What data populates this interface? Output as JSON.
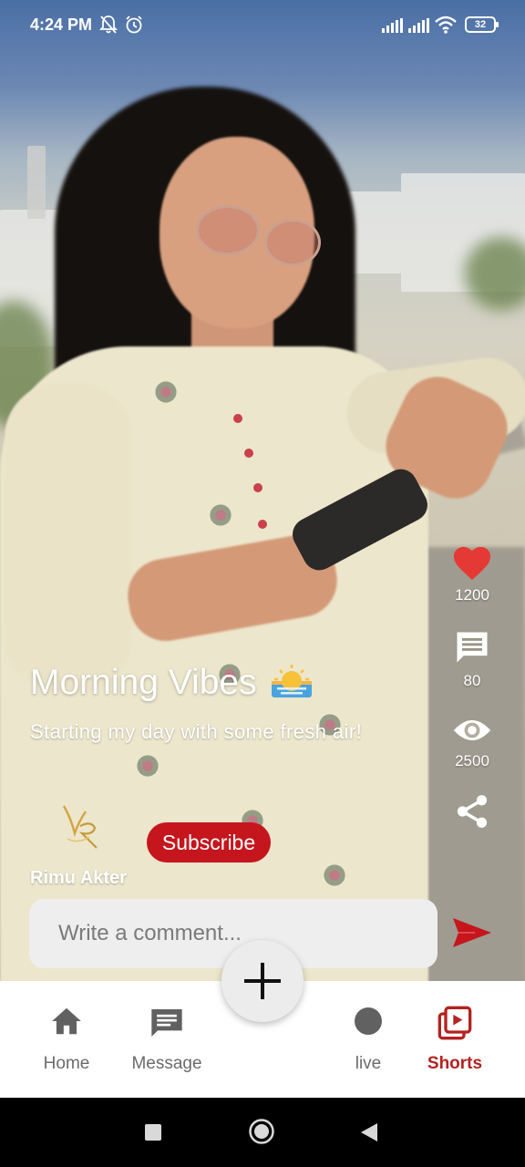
{
  "status_bar": {
    "time": "4:24 PM",
    "icons": [
      "mute-bell-icon",
      "alarm-icon",
      "signal-icon",
      "signal-icon",
      "wifi-icon"
    ],
    "battery": "32"
  },
  "video": {
    "title": "Morning Vibes",
    "title_emoji": "sunrise-icon",
    "description": "Starting my day with some fresh air!",
    "author": "Rimu Akter",
    "subscribe_label": "Subscribe"
  },
  "actions": {
    "likes": "1200",
    "comments": "80",
    "views": "2500",
    "like_color": "#e53935"
  },
  "comment": {
    "placeholder": "Write a comment..."
  },
  "bottom_nav": {
    "items": [
      {
        "label": "Home",
        "icon": "home-icon"
      },
      {
        "label": "Message",
        "icon": "message-icon"
      },
      {
        "label": "live",
        "icon": "live-dot-icon"
      },
      {
        "label": "Shorts",
        "icon": "shorts-icon"
      }
    ],
    "active": "Shorts",
    "accent": "#b3231f"
  }
}
